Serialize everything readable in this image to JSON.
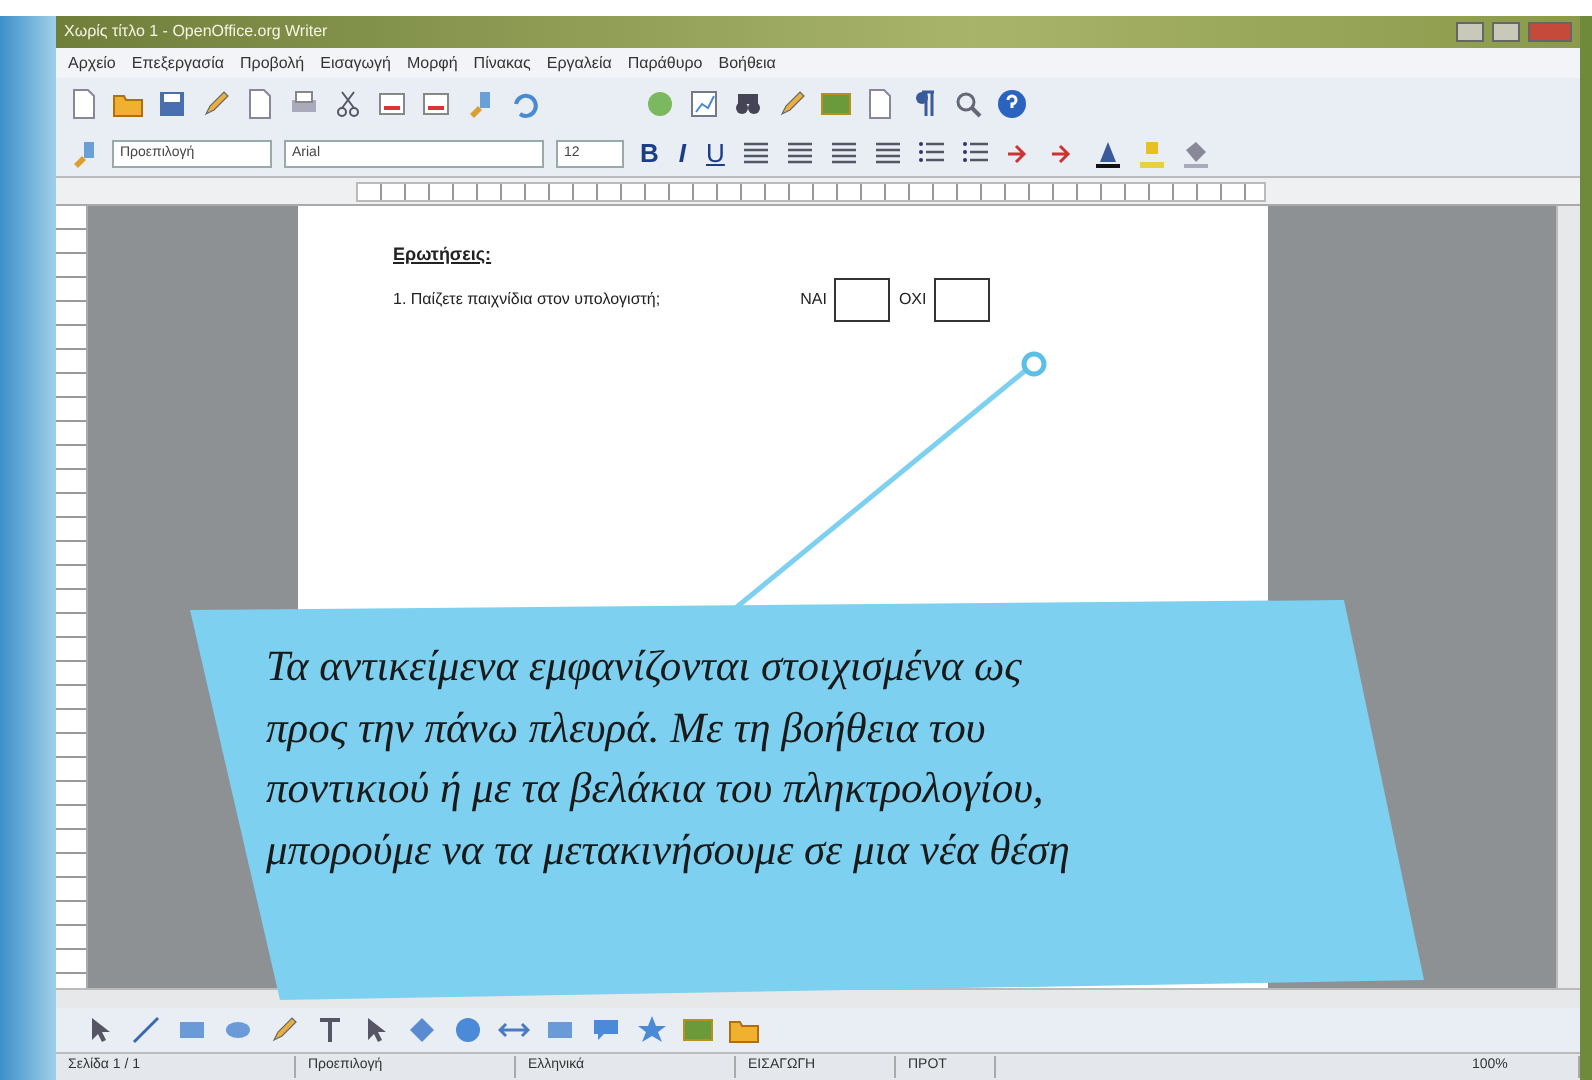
{
  "window": {
    "title": "Χωρίς τίτλο 1 - OpenOffice.org Writer"
  },
  "menu": [
    "Αρχείο",
    "Επεξεργασία",
    "Προβολή",
    "Εισαγωγή",
    "Μορφή",
    "Πίνακας",
    "Εργαλεία",
    "Παράθυρο",
    "Βοήθεια"
  ],
  "formatting": {
    "style": "Προεπιλογή",
    "font": "Arial",
    "size": "12",
    "buttons": [
      "B",
      "I",
      "U"
    ]
  },
  "document": {
    "heading": "Ερωτήσεις:",
    "question": "1. Παίζετε παιχνίδια στον υπολογιστή;",
    "options": [
      "ΝΑΙ",
      "ΟΧΙ"
    ]
  },
  "callout": {
    "lines": [
      "Τα αντικείμενα εμφανίζονται στοιχισμένα ως",
      "προς την πάνω πλευρά. Με τη βοήθεια του",
      "ποντικιού ή με τα βελάκια του πληκτρολογίου,",
      "μπορούμε να τα μετακινήσουμε σε μια νέα θέση"
    ]
  },
  "status_bar": [
    "Σελίδα 1 / 1",
    "Προεπιλογή",
    "Ελληνικά",
    "ΕΙΣΑΓΩΓΗ",
    "ΠΡΟΤ",
    "100%"
  ]
}
